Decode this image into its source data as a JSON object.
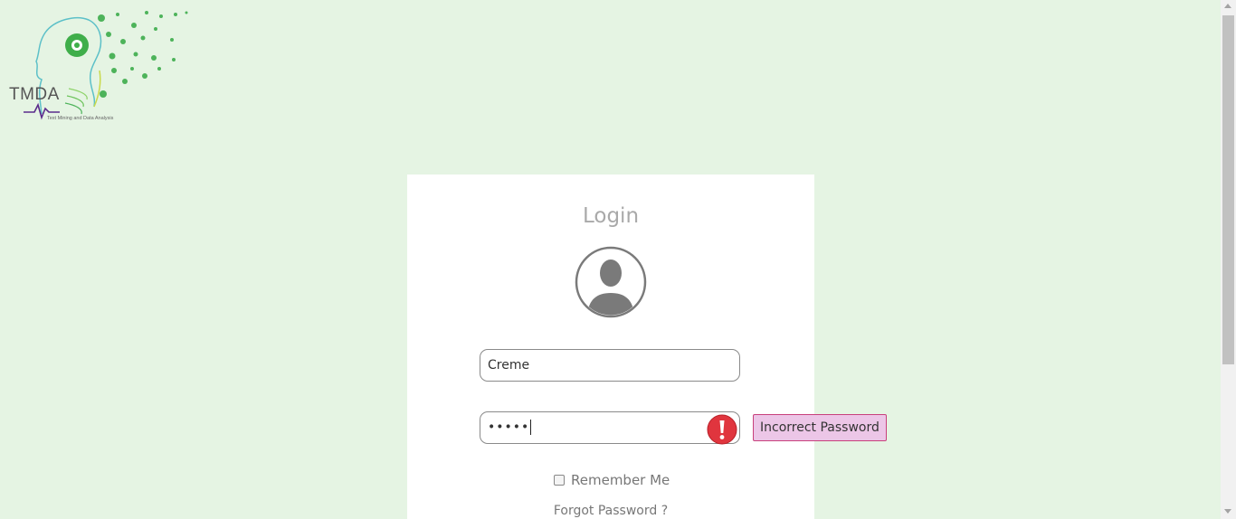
{
  "logo": {
    "text": "TMDA",
    "subtitle": "Text Mining and Data Analysis"
  },
  "login": {
    "title": "Login",
    "username_value": "Creme",
    "password_masked": "•••••",
    "remember_label": "Remember Me",
    "forgot_label": "Forgot Password ?"
  },
  "error": {
    "message": "Incorrect Password"
  },
  "colors": {
    "background": "#e5f4e3",
    "card": "#ffffff",
    "error_red": "#e0353e",
    "tooltip_bg": "#ecc6e7",
    "tooltip_border": "#c8407c"
  },
  "icons": {
    "avatar": "user-silhouette-icon",
    "error": "exclamation-circle-icon"
  }
}
